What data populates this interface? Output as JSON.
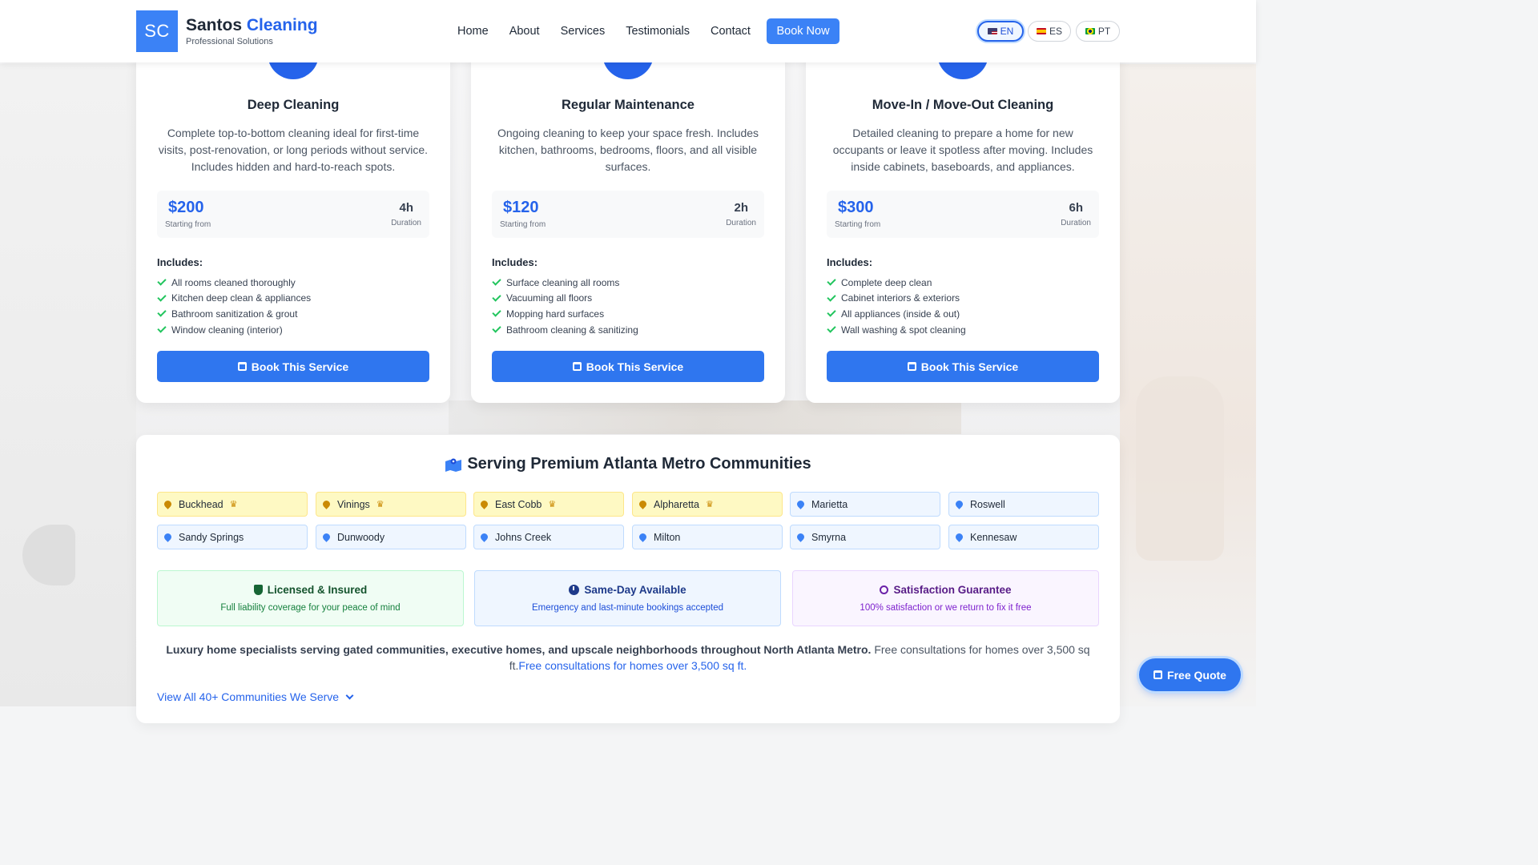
{
  "brand": {
    "logo_initials": "SC",
    "name_main": "Santos",
    "name_accent": "Cleaning",
    "tagline": "Professional Solutions"
  },
  "nav": {
    "items": [
      "Home",
      "About",
      "Services",
      "Testimonials",
      "Contact"
    ],
    "book_now": "Book Now"
  },
  "languages": [
    {
      "code": "EN",
      "active": true
    },
    {
      "code": "ES",
      "active": false
    },
    {
      "code": "PT",
      "active": false
    }
  ],
  "services": [
    {
      "title": "Deep Cleaning",
      "description": "Complete top-to-bottom cleaning ideal for first-time visits, post-renovation, or long periods without service. Includes hidden and hard-to-reach spots.",
      "price": "$200",
      "price_label": "Starting from",
      "duration": "4h",
      "duration_label": "Duration",
      "includes_label": "Includes:",
      "features": [
        "All rooms cleaned thoroughly",
        "Kitchen deep clean & appliances",
        "Bathroom sanitization & grout",
        "Window cleaning (interior)"
      ],
      "button": "Book This Service"
    },
    {
      "title": "Regular Maintenance",
      "description": "Ongoing cleaning to keep your space fresh. Includes kitchen, bathrooms, bedrooms, floors, and all visible surfaces.",
      "price": "$120",
      "price_label": "Starting from",
      "duration": "2h",
      "duration_label": "Duration",
      "includes_label": "Includes:",
      "features": [
        "Surface cleaning all rooms",
        "Vacuuming all floors",
        "Mopping hard surfaces",
        "Bathroom cleaning & sanitizing"
      ],
      "button": "Book This Service"
    },
    {
      "title": "Move-In / Move-Out Cleaning",
      "description": "Detailed cleaning to prepare a home for new occupants or leave it spotless after moving. Includes inside cabinets, baseboards, and appliances.",
      "price": "$300",
      "price_label": "Starting from",
      "duration": "6h",
      "duration_label": "Duration",
      "includes_label": "Includes:",
      "features": [
        "Complete deep clean",
        "Cabinet interiors & exteriors",
        "All appliances (inside & out)",
        "Wall washing & spot cleaning"
      ],
      "button": "Book This Service"
    }
  ],
  "communities": {
    "title": "Serving Premium Atlanta Metro Communities",
    "items": [
      {
        "name": "Buckhead",
        "premium": true
      },
      {
        "name": "Vinings",
        "premium": true
      },
      {
        "name": "East Cobb",
        "premium": true
      },
      {
        "name": "Alpharetta",
        "premium": true
      },
      {
        "name": "Marietta",
        "premium": false
      },
      {
        "name": "Roswell",
        "premium": false
      },
      {
        "name": "Sandy Springs",
        "premium": false
      },
      {
        "name": "Dunwoody",
        "premium": false
      },
      {
        "name": "Johns Creek",
        "premium": false
      },
      {
        "name": "Milton",
        "premium": false
      },
      {
        "name": "Smyrna",
        "premium": false
      },
      {
        "name": "Kennesaw",
        "premium": false
      }
    ],
    "features": [
      {
        "title": "Licensed & Insured",
        "desc": "Full liability coverage for your peace of mind",
        "color": "#16a34a",
        "icon": "shield-icon"
      },
      {
        "title": "Same-Day Available",
        "desc": "Emergency and last-minute bookings accepted",
        "color": "#2563eb",
        "icon": "clock-icon"
      },
      {
        "title": "Satisfaction Guarantee",
        "desc": "100% satisfaction or we return to fix it free",
        "color": "#9333ea",
        "icon": "award-icon"
      }
    ],
    "blurb_bold": "Luxury home specialists serving gated communities, executive homes, and upscale neighborhoods throughout North Atlanta Metro.",
    "blurb_plain": " Free consultations for homes over 3,500 sq ft.",
    "blurb_link": "Free consultations for homes over 3,500 sq ft.",
    "view_all": "View All 40+ Communities We Serve"
  },
  "floating_cta": "Free Quote",
  "colors": {
    "accent": "#3b82f6",
    "accent_dark": "#2563eb",
    "premium_bg": "#fef9c3"
  }
}
